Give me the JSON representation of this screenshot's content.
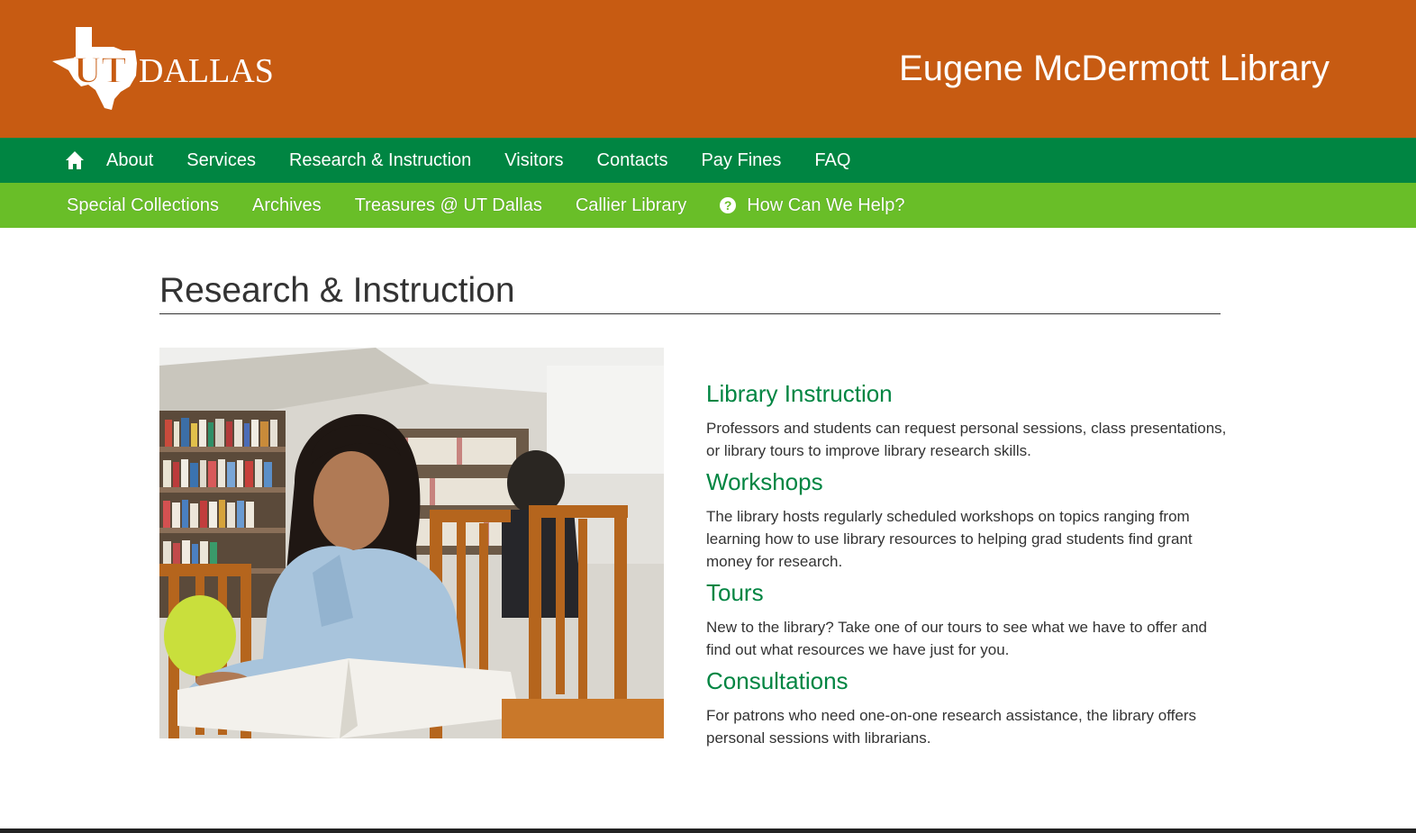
{
  "header": {
    "logo_text_ut": "UT",
    "logo_text_dallas": "DALLAS",
    "library_title": "Eugene McDermott Library",
    "brand_color": "#c75b12"
  },
  "nav_primary": {
    "home_icon": "home-icon",
    "items": [
      "About",
      "Services",
      "Research & Instruction",
      "Visitors",
      "Contacts",
      "Pay Fines",
      "FAQ"
    ],
    "color": "#008542"
  },
  "nav_secondary": {
    "items": [
      "Special Collections",
      "Archives",
      "Treasures @ UT Dallas",
      "Callier Library"
    ],
    "help_label": "How Can We Help?",
    "help_icon": "question-circle-icon",
    "color": "#69be28"
  },
  "main": {
    "page_title": "Research & Instruction",
    "sections": [
      {
        "heading": "Library Instruction",
        "text": "Professors and students can request personal sessions, class presentations, or library tours to improve library research skills."
      },
      {
        "heading": "Workshops",
        "text": "The library hosts regularly scheduled workshops on topics ranging from learning how to use library resources to helping grad students find grant money for research."
      },
      {
        "heading": "Tours",
        "text": "New to the library? Take one of our tours to see what we have to offer and find out what resources we have just for you."
      },
      {
        "heading": "Consultations",
        "text": "For patrons who need one-on-one research assistance, the library offers personal sessions with librarians."
      }
    ]
  }
}
